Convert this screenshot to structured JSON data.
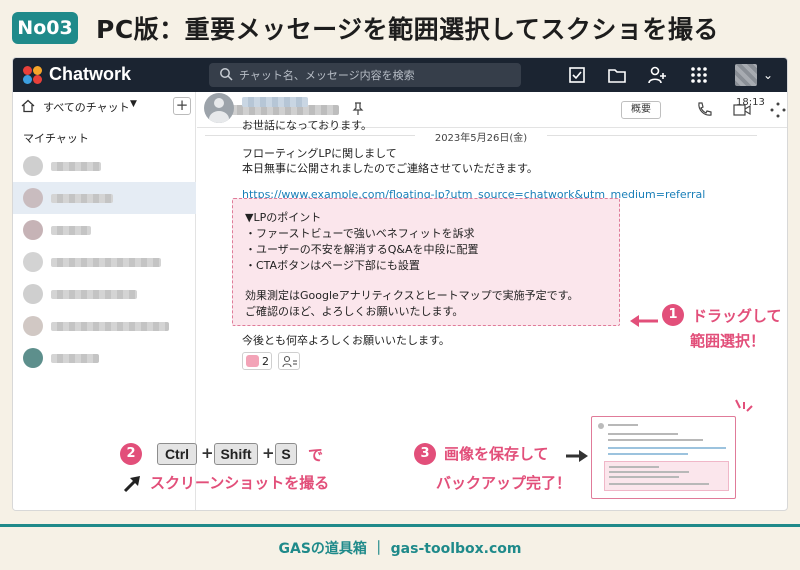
{
  "header": {
    "badge": "No03",
    "title": "PC版：重要メッセージを範囲選択してスクショを撮る"
  },
  "app": {
    "brand": "Chatwork",
    "search_placeholder": "チャット名、メッセージ内容を検索",
    "sidebar": {
      "title": "すべてのチャット",
      "add": "+",
      "my_chat": "マイチャット"
    },
    "chat_header": {
      "summary_button": "概要"
    },
    "date": "2023年5月26日(金)",
    "message": {
      "time": "18:13",
      "greeting": "お世話になっております。",
      "line1": "フローティングLPに関しまして",
      "line2": "本日無事に公開されましたのでご連絡させていただきます。",
      "url": "https://www.example.com/floating-lp?utm_source=chatwork&utm_medium=referral",
      "selected": {
        "heading": "▼LPのポイント",
        "bullet1": "・ファーストビューで強いベネフィットを訴求",
        "bullet2": "・ユーザーの不安を解消するQ&Aを中段に配置",
        "bullet3": "・CTAボタンはページ下部にも設置",
        "note1": "効果測定はGoogleアナリティクスとヒートマップで実施予定です。",
        "note2": "ご確認のほど、よろしくお願いいたします。"
      },
      "closing": "今後とも何卒よろしくお願いいたします。",
      "reaction_count": "2"
    }
  },
  "callouts": {
    "step1": {
      "num": "1",
      "line1": "ドラッグして",
      "line2": "範囲選択！"
    },
    "step2": {
      "num": "2",
      "keys": [
        "Ctrl",
        "Shift",
        "S"
      ],
      "plus": "+",
      "suffix": "で",
      "text": "スクリーンショットを撮る"
    },
    "step3": {
      "num": "3",
      "line1": "画像を保存して",
      "line2": "バックアップ完了！"
    }
  },
  "footer": {
    "text": "GASの道具箱 ｜ gas-toolbox.com"
  },
  "colors": {
    "accent": "#1f8a8a",
    "pink": "#e24f7a",
    "topbar": "#1b2431",
    "link": "#1a7fb8"
  }
}
